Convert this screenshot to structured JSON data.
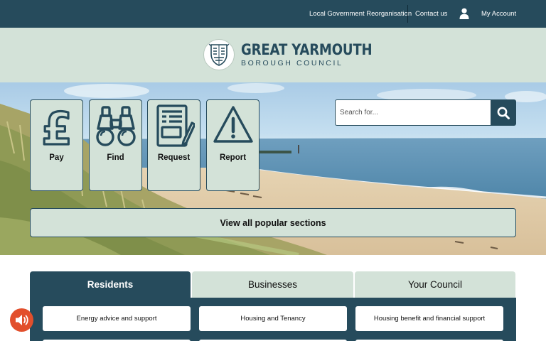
{
  "topbar": {
    "links": [
      {
        "label": "Local Government Reorganisation"
      },
      {
        "label": "Contact us"
      },
      {
        "label": "My Account"
      }
    ],
    "account_icon": "user-icon"
  },
  "header": {
    "logo_title": "GREAT YARMOUTH",
    "logo_subtitle": "BOROUGH COUNCIL",
    "crest_icon": "council-crest"
  },
  "hero": {
    "tiles": [
      {
        "label": "Pay",
        "icon": "pound-icon"
      },
      {
        "label": "Find",
        "icon": "binoculars-icon"
      },
      {
        "label": "Request",
        "icon": "form-icon"
      },
      {
        "label": "Report",
        "icon": "warning-icon"
      }
    ],
    "search": {
      "placeholder": "Search for...",
      "value": "",
      "icon": "search-icon"
    },
    "view_all_label": "View all popular sections"
  },
  "tabs": [
    {
      "label": "Residents",
      "active": true
    },
    {
      "label": "Businesses",
      "active": false
    },
    {
      "label": "Your Council",
      "active": false
    }
  ],
  "services": [
    {
      "label": "Energy advice and support"
    },
    {
      "label": "Housing and Tenancy"
    },
    {
      "label": "Housing benefit and financial support"
    }
  ],
  "audio": {
    "icon": "speaker-icon"
  },
  "colors": {
    "brand_dark": "#264b5c",
    "brand_light": "#d3e2d8",
    "accent": "#e24f2c"
  }
}
